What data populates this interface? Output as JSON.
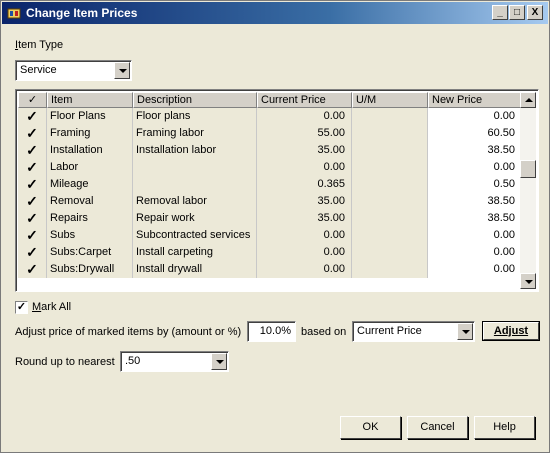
{
  "window": {
    "title": "Change Item Prices",
    "minimize": "_",
    "maximize": "□",
    "close": "X"
  },
  "item_type": {
    "label_pre": "",
    "label_accel": "I",
    "label_post": "tem Type",
    "value": "Service"
  },
  "grid": {
    "columns": [
      "✓",
      "Item",
      "Description",
      "Current Price",
      "U/M",
      "New Price"
    ],
    "rows": [
      {
        "checked": "✓",
        "item": "Floor Plans",
        "description": "Floor plans",
        "current": "0.00",
        "um": "",
        "new": "0.00"
      },
      {
        "checked": "✓",
        "item": "Framing",
        "description": "Framing labor",
        "current": "55.00",
        "um": "",
        "new": "60.50"
      },
      {
        "checked": "✓",
        "item": "Installation",
        "description": "Installation labor",
        "current": "35.00",
        "um": "",
        "new": "38.50"
      },
      {
        "checked": "✓",
        "item": "Labor",
        "description": "",
        "current": "0.00",
        "um": "",
        "new": "0.00"
      },
      {
        "checked": "✓",
        "item": "Mileage",
        "description": "",
        "current": "0.365",
        "um": "",
        "new": "0.50"
      },
      {
        "checked": "✓",
        "item": "Removal",
        "description": "Removal labor",
        "current": "35.00",
        "um": "",
        "new": "38.50"
      },
      {
        "checked": "✓",
        "item": "Repairs",
        "description": "Repair work",
        "current": "35.00",
        "um": "",
        "new": "38.50"
      },
      {
        "checked": "✓",
        "item": "Subs",
        "description": "Subcontracted services",
        "current": "0.00",
        "um": "",
        "new": "0.00"
      },
      {
        "checked": "✓",
        "item": "Subs:Carpet",
        "description": "Install carpeting",
        "current": "0.00",
        "um": "",
        "new": "0.00"
      },
      {
        "checked": "✓",
        "item": "Subs:Drywall",
        "description": "Install drywall",
        "current": "0.00",
        "um": "",
        "new": "0.00"
      }
    ]
  },
  "mark_all": {
    "checked": "✓",
    "label_accel": "M",
    "label_post": "ark All"
  },
  "adjust": {
    "label": "Adjust price of marked items by (amount or %)",
    "amount": "10.0%",
    "based_on_label": "based on",
    "based_on_value": "Current Price",
    "button_label": "Adjust"
  },
  "round": {
    "label": "Round up to nearest",
    "value": ".50"
  },
  "buttons": {
    "ok": "OK",
    "cancel": "Cancel",
    "help": "Help"
  }
}
